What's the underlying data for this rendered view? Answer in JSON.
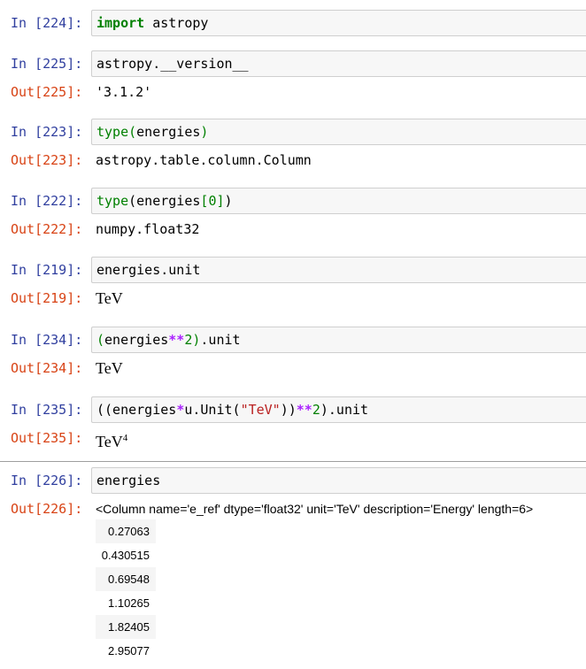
{
  "cells": [
    {
      "in_prompt": "In [224]:",
      "input_tokens": [
        [
          "kw",
          "import"
        ],
        [
          "",
          "astropy"
        ]
      ]
    },
    {
      "in_prompt": "In [225]:",
      "input_tokens": [
        [
          "",
          "astropy.__version__"
        ]
      ],
      "out_prompt": "Out[225]:",
      "output": "'3.1.2'"
    },
    {
      "in_prompt": "In [223]:",
      "out_prompt": "Out[223]:",
      "output": "astropy.table.column.Column"
    },
    {
      "in_prompt": "In [222]:",
      "out_prompt": "Out[222]:",
      "output": "numpy.float32"
    },
    {
      "in_prompt": "In [219]:",
      "input": "energies.unit",
      "out_prompt": "Out[219]:",
      "output": "TeV"
    },
    {
      "in_prompt": "In [234]:",
      "out_prompt": "Out[234]:",
      "output": "TeV"
    },
    {
      "in_prompt": "In [235]:",
      "out_prompt": "Out[235]:",
      "output": "TeV",
      "output_sup": "4"
    },
    {
      "in_prompt": "In [226]:",
      "input": "energies",
      "out_prompt": "Out[226]:",
      "output": "<Column name='e_ref' dtype='float32' unit='TeV' description='Energy' length=6>"
    }
  ],
  "code": {
    "c0_kw": "import",
    "c0_rest": " astropy",
    "c1": "astropy.__version__",
    "c2_fn": "type",
    "c2_p1": "(",
    "c2_arg": "energies",
    "c2_p2": ")",
    "c3_fn": "type",
    "c3_p1": "(",
    "c3_arg": "energies",
    "c3_b1": "[",
    "c3_idx": "0",
    "c3_b2": "]",
    "c3_p2": ")",
    "c5_p1": "(",
    "c5_arg": "energies",
    "c5_op": "**",
    "c5_num": "2",
    "c5_p2": ")",
    "c5_rest": ".unit",
    "c6_a": "((energies",
    "c6_op": "*",
    "c6_b": "u.Unit(",
    "c6_str": "\"TeV\"",
    "c6_c": "))",
    "c6_op2": "**",
    "c6_num": "2",
    "c6_d": ").unit"
  },
  "table_values": [
    "0.27063",
    "0.430515",
    "0.69548",
    "1.10265",
    "1.82405",
    "2.95077"
  ]
}
